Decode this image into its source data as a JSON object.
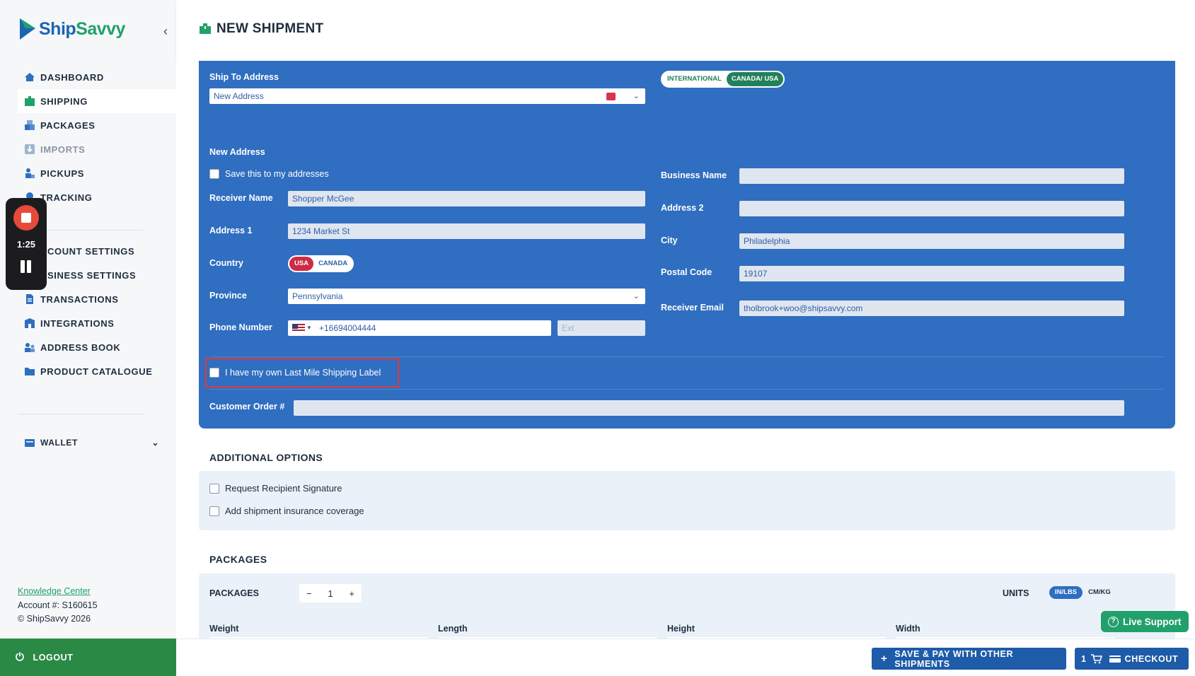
{
  "brand": {
    "name_part1": "Ship",
    "name_part2": "Savvy"
  },
  "sidebar": {
    "items": [
      {
        "label": "DASHBOARD",
        "icon": "home-icon"
      },
      {
        "label": "SHIPPING",
        "icon": "shipping-box-icon",
        "active": true
      },
      {
        "label": "PACKAGES",
        "icon": "packages-icon"
      },
      {
        "label": "IMPORTS",
        "icon": "imports-icon",
        "disabled": true
      },
      {
        "label": "PICKUPS",
        "icon": "pickup-icon"
      },
      {
        "label": "TRACKING",
        "icon": "tracking-icon"
      }
    ],
    "settings_items": [
      {
        "label": "ACCOUNT SETTINGS",
        "visible": "CCOUNT SETTINGS"
      },
      {
        "label": "BUSINESS SETTINGS",
        "visible": "USINESS SETTINGS"
      },
      {
        "label": "TRANSACTIONS"
      },
      {
        "label": "INTEGRATIONS"
      },
      {
        "label": "ADDRESS BOOK"
      },
      {
        "label": "PRODUCT CATALOGUE"
      }
    ],
    "wallet": "WALLET",
    "footer": {
      "knowledge_center": "Knowledge Center",
      "account": "Account #: S160615",
      "copyright": "© ShipSavvy 2026"
    },
    "logout": "LOGOUT"
  },
  "recorder": {
    "time": "1:25"
  },
  "header": {
    "title": "NEW SHIPMENT"
  },
  "form": {
    "ship_to_label": "Ship To Address",
    "ship_to_value": "New Address",
    "region_toggle": {
      "opt1": "INTERNATIONAL",
      "opt2": "CANADA/ USA",
      "selected": "CANADA/ USA"
    },
    "new_address_heading": "New Address",
    "save_address_label": "Save this to my addresses",
    "receiver_name_label": "Receiver Name",
    "receiver_name_value": "Shopper McGee",
    "address1_label": "Address 1",
    "address1_value": "1234 Market St",
    "country_label": "Country",
    "country_toggle": {
      "opt1": "USA",
      "opt2": "CANADA",
      "selected": "USA"
    },
    "province_label": "Province",
    "province_value": "Pennsylvania",
    "phone_label": "Phone Number",
    "phone_value": "+16694004444",
    "ext_placeholder": "Ext",
    "business_name_label": "Business Name",
    "business_name_value": "",
    "address2_label": "Address 2",
    "address2_value": "",
    "city_label": "City",
    "city_value": "Philadelphia",
    "postal_label": "Postal Code",
    "postal_value": "19107",
    "email_label": "Receiver Email",
    "email_value": "tholbrook+woo@shipsavvy.com",
    "last_mile_label": "I have my own Last Mile Shipping Label",
    "order_label": "Customer Order #",
    "order_value": ""
  },
  "additional": {
    "title": "ADDITIONAL OPTIONS",
    "signature": "Request Recipient Signature",
    "insurance": "Add shipment insurance coverage"
  },
  "packages": {
    "title": "PACKAGES",
    "count_label": "PACKAGES",
    "count": "1",
    "minus": "−",
    "plus": "+",
    "units_label": "UNITS",
    "units_opt1": "IN/LBS",
    "units_opt2": "CM/KG",
    "weight": "Weight",
    "length": "Length",
    "height": "Height",
    "width": "Width"
  },
  "live_support": "Live Support",
  "bottom": {
    "save_pay": "SAVE & PAY WITH OTHER SHIPMENTS",
    "cart_count": "1",
    "checkout": "CHECKOUT"
  },
  "colors": {
    "brand_blue": "#1b65b3",
    "brand_green": "#22a06b",
    "card_blue": "#2f6ec0",
    "logout_green": "#2a8a45",
    "highlight_red": "#e13a3a"
  }
}
